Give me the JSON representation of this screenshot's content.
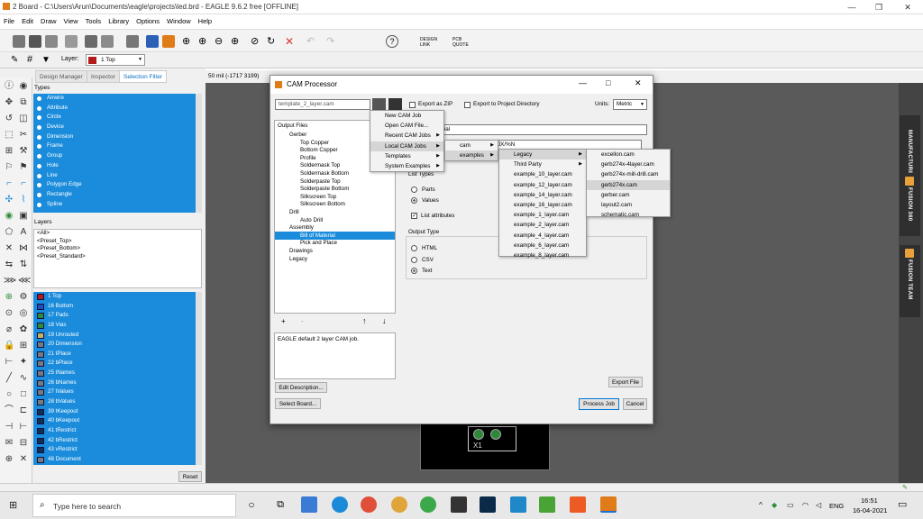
{
  "window": {
    "title": "2 Board - C:\\Users\\Arun\\Documents\\eagle\\projects\\led.brd - EAGLE 9.6.2 free [OFFLINE]"
  },
  "menu": [
    "File",
    "Edit",
    "Draw",
    "View",
    "Tools",
    "Library",
    "Options",
    "Window",
    "Help"
  ],
  "toolbar": {
    "design_link": "DESIGN LINK",
    "pcb_quote": "PCB QUOTE"
  },
  "layerbar": {
    "label": "Layer:",
    "value": "1 Top"
  },
  "tabs": [
    "Design Manager",
    "Inspector",
    "Selection Filter"
  ],
  "types_header": "Types",
  "types": [
    "Airwire",
    "Attribute",
    "Circle",
    "Device",
    "Dimension",
    "Frame",
    "Group",
    "Hole",
    "Line",
    "Polygon Edge",
    "Rectangle",
    "Spline"
  ],
  "layers_header": "Layers",
  "presets": [
    "<All>",
    "<Preset_Top>",
    "<Preset_Bottom>",
    "<Preset_Standard>"
  ],
  "layers": [
    {
      "label": "1 Top",
      "color": "#b31b1b"
    },
    {
      "label": "16 Bottom",
      "color": "#1e4fb5"
    },
    {
      "label": "17 Pads",
      "color": "#2e8b3a"
    },
    {
      "label": "18 Vias",
      "color": "#2e8b3a"
    },
    {
      "label": "19 Unrouted",
      "color": "#c8b060"
    },
    {
      "label": "20 Dimension",
      "color": "#7a7a7a"
    },
    {
      "label": "21 tPlace",
      "color": "#7a7a7a"
    },
    {
      "label": "22 bPlace",
      "color": "#7a7a7a"
    },
    {
      "label": "25 tNames",
      "color": "#7a7a7a"
    },
    {
      "label": "26 bNames",
      "color": "#7a7a7a"
    },
    {
      "label": "27 tValues",
      "color": "#7a7a7a"
    },
    {
      "label": "28 bValues",
      "color": "#7a7a7a"
    },
    {
      "label": "39 tKeepout",
      "color": "#12304f"
    },
    {
      "label": "40 bKeepout",
      "color": "#12304f"
    },
    {
      "label": "41 tRestrict",
      "color": "#12304f"
    },
    {
      "label": "42 bRestrict",
      "color": "#12304f"
    },
    {
      "label": "43 vRestrict",
      "color": "#12304f"
    },
    {
      "label": "48 Document",
      "color": "#7a7a7a"
    }
  ],
  "reset_label": "Reset",
  "canvas_coords": "50 mil (-1717 3199)",
  "board_label": "X1",
  "right_tabs": [
    "MANUFACTURING",
    "FUSION 360",
    "FUSION TEAM"
  ],
  "dialog": {
    "title": "CAM Processor",
    "job_file": "template_2_layer.cam",
    "export_zip": "Export as ZIP",
    "export_dir": "Export to Project Directory",
    "units_label": "Units:",
    "units_value": "Metric",
    "name_field": "aterial",
    "path_field": "JX/%N",
    "output_header": "Output Files",
    "tree": [
      {
        "label": "Gerber",
        "level": 1
      },
      {
        "label": "Top Copper",
        "level": 2
      },
      {
        "label": "Bottom Copper",
        "level": 2
      },
      {
        "label": "Profile",
        "level": 2
      },
      {
        "label": "Soldermask Top",
        "level": 2
      },
      {
        "label": "Soldermask Bottom",
        "level": 2
      },
      {
        "label": "Solderpaste Top",
        "level": 2
      },
      {
        "label": "Solderpaste Bottom",
        "level": 2
      },
      {
        "label": "Silkscreen Top",
        "level": 2
      },
      {
        "label": "Silkscreen Bottom",
        "level": 2
      },
      {
        "label": "Drill",
        "level": 1
      },
      {
        "label": "Auto Drill",
        "level": 2
      },
      {
        "label": "Assembly",
        "level": 1
      },
      {
        "label": "Bill of Material",
        "level": 2
      },
      {
        "label": "Pick and Place",
        "level": 2
      },
      {
        "label": "Drawings",
        "level": 1
      },
      {
        "label": "Legacy",
        "level": 1
      }
    ],
    "list_types": "List Types",
    "parts": "Parts",
    "values": "Values",
    "list_attributes": "List attributes",
    "output_type": "Output Type",
    "html": "HTML",
    "csv": "CSV",
    "text": "Text",
    "description": "EAGLE default 2 layer CAM job.",
    "edit_description": "Edit Description...",
    "select_board": "Select Board...",
    "export_file": "Export File",
    "process_job": "Process Job",
    "cancel": "Cancel",
    "tree_buttons": {
      "add": "+",
      "remove": "-",
      "up": "↑",
      "down": "↓"
    }
  },
  "menu1": [
    "New CAM Job",
    "Open CAM File...",
    "Recent CAM Jobs",
    "Local CAM Jobs",
    "Templates",
    "System Examples"
  ],
  "menu2": [
    "cam",
    "examples"
  ],
  "menu3": [
    "Legacy",
    "Third Party",
    "example_10_layer.cam",
    "example_12_layer.cam",
    "example_14_layer.cam",
    "example_16_layer.cam",
    "example_1_layer.cam",
    "example_2_layer.cam",
    "example_4_layer.cam",
    "example_6_layer.cam",
    "example_8_layer.cam"
  ],
  "menu4": [
    "excellon.cam",
    "gerb274x-4layer.cam",
    "gerb274x-mill-drill.cam",
    "gerb274x.cam",
    "gerber.cam",
    "layout2.cam",
    "schematic.cam"
  ],
  "taskbar": {
    "search": "Type here to search",
    "time": "16:51",
    "date": "16-04-2021",
    "lang": "ENG"
  }
}
